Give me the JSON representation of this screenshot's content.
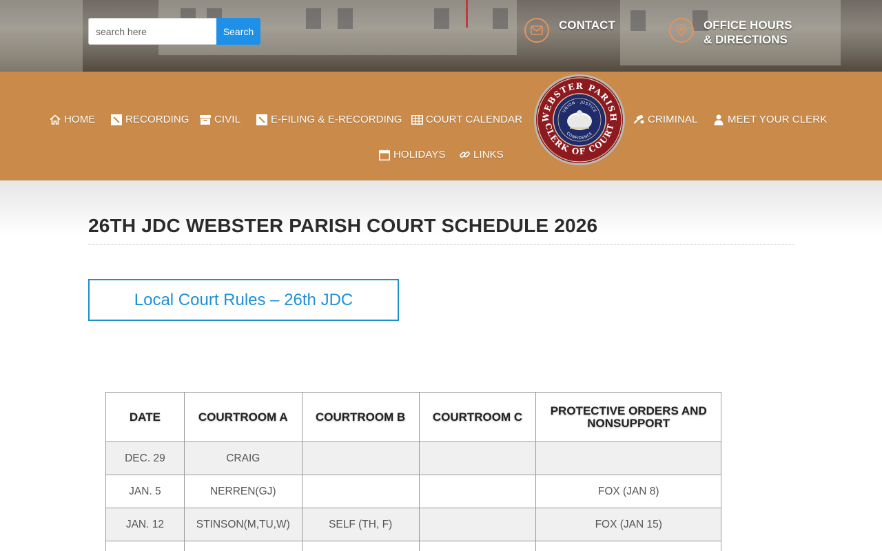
{
  "search": {
    "placeholder": "search here",
    "button_label": "Search"
  },
  "top_links": {
    "contact": "CONTACT",
    "office_hours_line1": "OFFICE HOURS",
    "office_hours_line2": "& DIRECTIONS"
  },
  "nav": {
    "items": [
      {
        "label": "HOME",
        "icon": "home-icon"
      },
      {
        "label": "RECORDING",
        "icon": "edit-icon"
      },
      {
        "label": "CIVIL",
        "icon": "archive-icon"
      },
      {
        "label": "E-FILING & E-RECORDING",
        "icon": "edit-icon"
      },
      {
        "label": "COURT CALENDAR",
        "icon": "table-icon"
      },
      {
        "label": "CRIMINAL",
        "icon": "gavel-icon"
      },
      {
        "label": "MEET YOUR CLERK",
        "icon": "user-icon"
      },
      {
        "label": "HOLIDAYS",
        "icon": "calendar-icon"
      },
      {
        "label": "LINKS",
        "icon": "link-icon"
      }
    ]
  },
  "logo": {
    "outer_top": "WEBSTER PARISH",
    "outer_bottom": "CLERK OF COURT",
    "inner_top": "UNION · JUSTICE",
    "inner_bottom": "CONFIDENCE"
  },
  "main": {
    "title": "26TH JDC WEBSTER PARISH COURT SCHEDULE 2026",
    "rules_button": "Local Court Rules – 26th JDC"
  },
  "schedule": {
    "headers": [
      "DATE",
      "COURTROOM A",
      "COURTROOM B",
      "COURTROOM C",
      "PROTECTIVE ORDERS AND NONSUPPORT"
    ],
    "rows": [
      [
        "DEC. 29",
        "CRAIG",
        "",
        "",
        ""
      ],
      [
        "JAN. 5",
        "NERREN(GJ)",
        "",
        "",
        "FOX (JAN 8)"
      ],
      [
        "JAN. 12",
        "STINSON(M,TU,W)",
        "SELF (TH, F)",
        "",
        "FOX (JAN 15)"
      ],
      [
        "",
        "",
        "",
        "",
        ""
      ]
    ]
  },
  "colors": {
    "nav_bg": "#c98a4a",
    "accent_blue": "#1e90e8",
    "icon_ring": "#e5935a",
    "seal_navy": "#1f2b6b",
    "seal_red": "#8c1a1f"
  }
}
